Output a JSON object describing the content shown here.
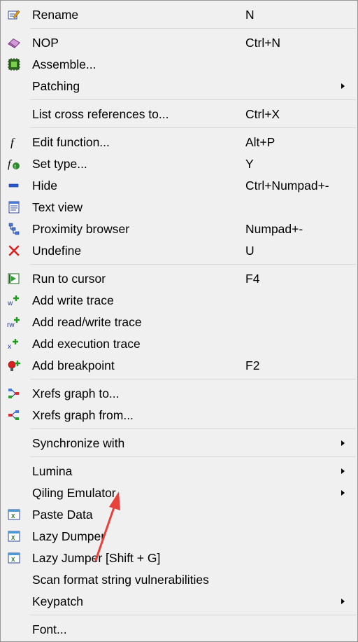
{
  "menu": {
    "items": [
      {
        "label": "Rename",
        "shortcut": "N",
        "icon": "rename-icon"
      },
      {
        "label": "NOP",
        "shortcut": "Ctrl+N",
        "icon": "eraser-icon"
      },
      {
        "label": "Assemble...",
        "shortcut": "",
        "icon": "chip-icon"
      },
      {
        "label": "Patching",
        "shortcut": "",
        "icon": "",
        "submenu": true
      },
      {
        "label": "List cross references to...",
        "shortcut": "Ctrl+X",
        "icon": ""
      },
      {
        "label": "Edit function...",
        "shortcut": "Alt+P",
        "icon": "function-icon"
      },
      {
        "label": "Set type...",
        "shortcut": "Y",
        "icon": "type-icon"
      },
      {
        "label": "Hide",
        "shortcut": "Ctrl+Numpad+-",
        "icon": "hide-icon"
      },
      {
        "label": "Text view",
        "shortcut": "",
        "icon": "text-view-icon"
      },
      {
        "label": "Proximity browser",
        "shortcut": "Numpad+-",
        "icon": "proximity-icon"
      },
      {
        "label": "Undefine",
        "shortcut": "U",
        "icon": "undefine-icon"
      },
      {
        "label": "Run to cursor",
        "shortcut": "F4",
        "icon": "run-icon"
      },
      {
        "label": "Add write trace",
        "shortcut": "",
        "icon": "write-trace-icon"
      },
      {
        "label": "Add read/write trace",
        "shortcut": "",
        "icon": "read-write-trace-icon"
      },
      {
        "label": "Add execution trace",
        "shortcut": "",
        "icon": "execution-trace-icon"
      },
      {
        "label": "Add breakpoint",
        "shortcut": "F2",
        "icon": "breakpoint-icon"
      },
      {
        "label": "Xrefs graph to...",
        "shortcut": "",
        "icon": "xrefs-to-icon"
      },
      {
        "label": "Xrefs graph from...",
        "shortcut": "",
        "icon": "xrefs-from-icon"
      },
      {
        "label": "Synchronize with",
        "shortcut": "",
        "icon": "",
        "submenu": true
      },
      {
        "label": "Lumina",
        "shortcut": "",
        "icon": "",
        "submenu": true
      },
      {
        "label": "Qiling Emulator",
        "shortcut": "",
        "icon": "",
        "submenu": true
      },
      {
        "label": "Paste Data",
        "shortcut": "",
        "icon": "plugin-icon"
      },
      {
        "label": "Lazy Dumper",
        "shortcut": "",
        "icon": "plugin-icon"
      },
      {
        "label": "Lazy Jumper [Shift + G]",
        "shortcut": "",
        "icon": "plugin-icon"
      },
      {
        "label": "Scan format string vulnerabilities",
        "shortcut": "",
        "icon": ""
      },
      {
        "label": "Keypatch",
        "shortcut": "",
        "icon": "",
        "submenu": true
      },
      {
        "label": "Font...",
        "shortcut": "",
        "icon": ""
      }
    ]
  },
  "colors": {
    "arrow": "#e8413b",
    "menu_bg": "#f0f0f0",
    "separator": "#d7d7d7"
  }
}
